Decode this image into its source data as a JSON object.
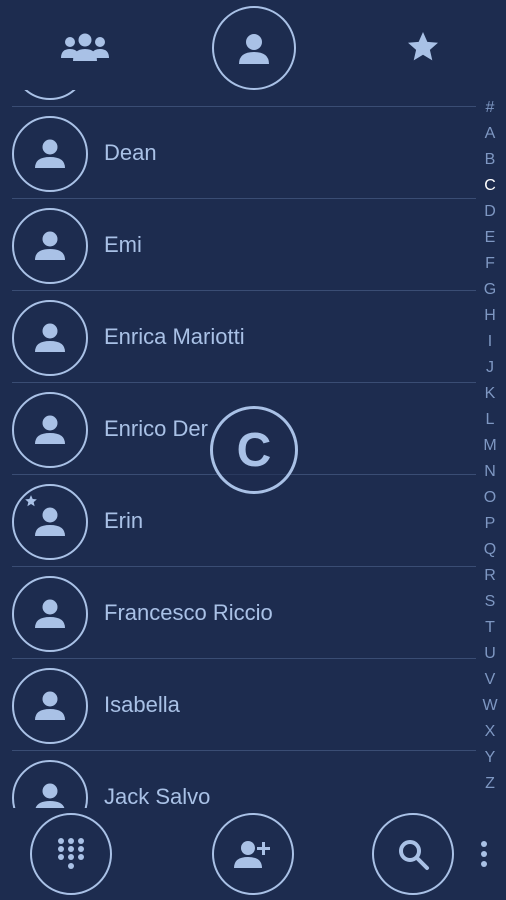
{
  "colors": {
    "background": "#1d2c4f",
    "accent": "#a9c1e6",
    "divider": "#3a4d74",
    "index_inactive": "#7e97c2",
    "index_active": "#ffffff"
  },
  "top_tabs": [
    {
      "name": "groups",
      "icon": "groups-icon",
      "selected": false
    },
    {
      "name": "contacts",
      "icon": "person-icon",
      "selected": true
    },
    {
      "name": "favorites",
      "icon": "star-icon",
      "selected": false
    }
  ],
  "contacts": [
    {
      "name": "Dean",
      "favorite": false
    },
    {
      "name": "Emi",
      "favorite": false
    },
    {
      "name": "Enrica Mariotti",
      "favorite": false
    },
    {
      "name": "Enrico Der",
      "favorite": false
    },
    {
      "name": "Erin",
      "favorite": true
    },
    {
      "name": "Francesco Riccio",
      "favorite": false
    },
    {
      "name": "Isabella",
      "favorite": false
    },
    {
      "name": "Jack Salvo",
      "favorite": false
    }
  ],
  "alpha_index": {
    "letters": [
      "#",
      "A",
      "B",
      "C",
      "D",
      "E",
      "F",
      "G",
      "H",
      "I",
      "J",
      "K",
      "L",
      "M",
      "N",
      "O",
      "P",
      "Q",
      "R",
      "S",
      "T",
      "U",
      "V",
      "W",
      "X",
      "Y",
      "Z"
    ],
    "active": "C"
  },
  "section_bubble": "C",
  "bottom_actions": [
    {
      "name": "dialpad",
      "icon": "dialpad-icon"
    },
    {
      "name": "add-contact",
      "icon": "add-person-icon"
    },
    {
      "name": "search",
      "icon": "search-icon"
    },
    {
      "name": "overflow-menu",
      "icon": "more-vert-icon"
    }
  ]
}
